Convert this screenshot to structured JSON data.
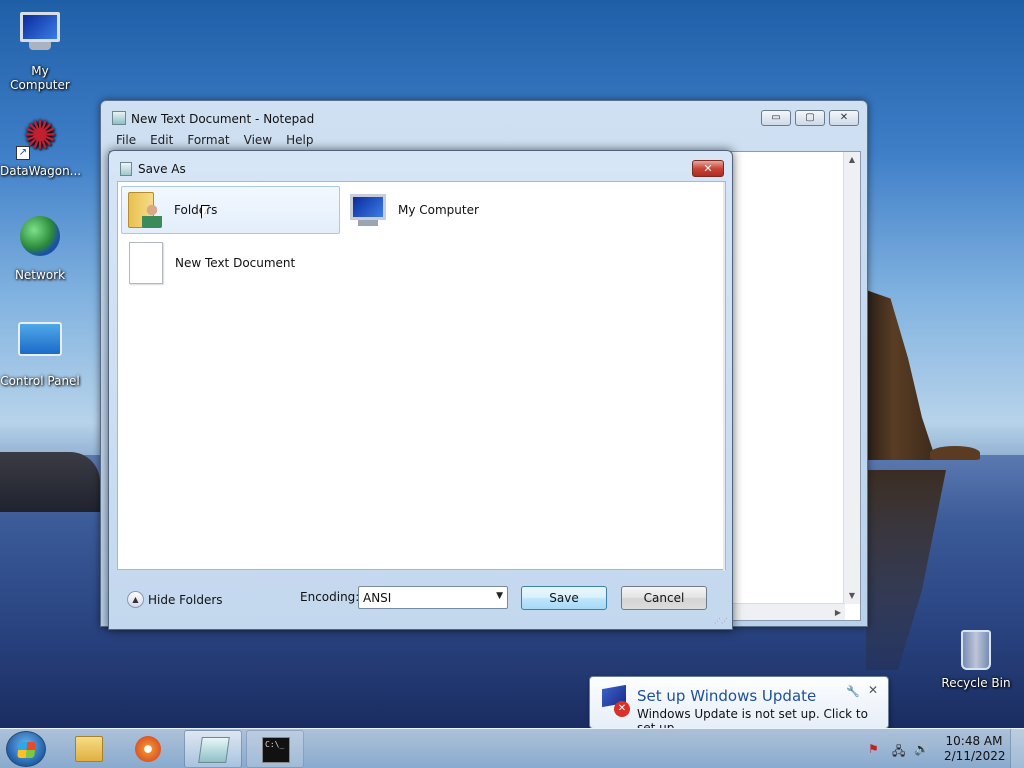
{
  "desktop": {
    "icons": [
      {
        "label": "My Computer"
      },
      {
        "label": "DataWagon..."
      },
      {
        "label": "Network"
      },
      {
        "label": "Control Panel"
      }
    ],
    "recycle_bin": "Recycle Bin"
  },
  "notepad": {
    "title": "New Text Document - Notepad",
    "menu": [
      "File",
      "Edit",
      "Format",
      "View",
      "Help"
    ],
    "caption": {
      "minimize": "▭",
      "maximize": "▢",
      "close": "✕"
    }
  },
  "save_dialog": {
    "title": "Save As",
    "close": "✕",
    "items": [
      {
        "label": "Folders",
        "icon": "user-folder-icon",
        "selected": true
      },
      {
        "label": "My Computer",
        "icon": "computer-icon",
        "selected": false
      },
      {
        "label": "New Text Document",
        "icon": "text-document-icon",
        "selected": false
      }
    ],
    "hide_folders": "Hide Folders",
    "encoding_label": "Encoding:",
    "encoding_value": "ANSI",
    "save_label": "Save",
    "cancel_label": "Cancel"
  },
  "balloon": {
    "title": "Set up Windows Update",
    "text": "Windows Update is not set up. Click to set up."
  },
  "taskbar": {
    "clock_time": "10:48 AM",
    "clock_date": "2/11/2022",
    "cmd_icon_text": "C:\\_"
  },
  "colors": {
    "accent": "#1e4f9e",
    "close_red": "#c8463a",
    "selection": "#e3eefb"
  }
}
